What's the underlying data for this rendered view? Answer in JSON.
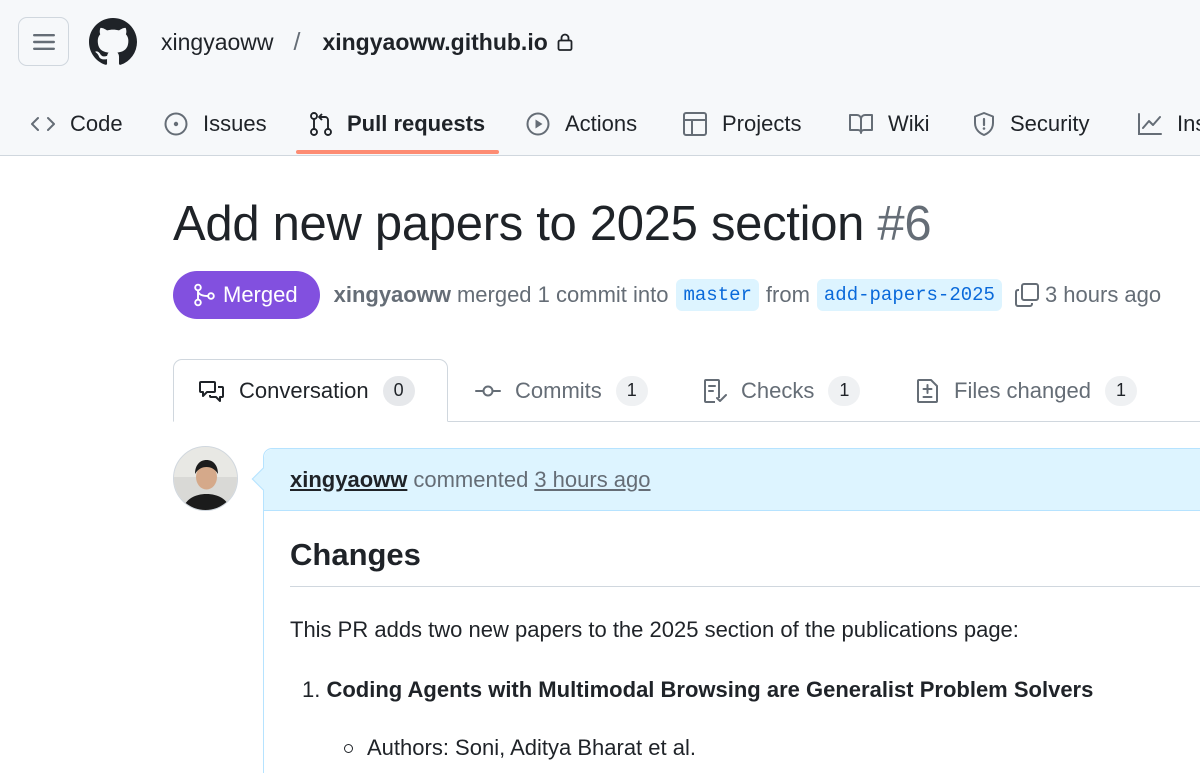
{
  "header": {
    "owner": "xingyaoww",
    "separator": "/",
    "repo": "xingyaoww.github.io",
    "tabs": [
      {
        "label": "Code",
        "icon": "code-icon"
      },
      {
        "label": "Issues",
        "icon": "issue-icon"
      },
      {
        "label": "Pull requests",
        "icon": "pull-request-icon",
        "active": true
      },
      {
        "label": "Actions",
        "icon": "play-icon"
      },
      {
        "label": "Projects",
        "icon": "table-icon"
      },
      {
        "label": "Wiki",
        "icon": "book-icon"
      },
      {
        "label": "Security",
        "icon": "shield-icon"
      },
      {
        "label": "Ins",
        "icon": "graph-icon"
      }
    ]
  },
  "pr": {
    "title": "Add new papers to 2025 section",
    "number": "#6",
    "state": "Merged",
    "author": "xingyaoww",
    "action_text": "merged 1 commit into",
    "base_branch": "master",
    "from_text": "from",
    "head_branch": "add-papers-2025",
    "time": "3 hours ago"
  },
  "pr_tabs": [
    {
      "label": "Conversation",
      "count": "0",
      "icon": "comment-discussion-icon"
    },
    {
      "label": "Commits",
      "count": "1",
      "icon": "commit-icon"
    },
    {
      "label": "Checks",
      "count": "1",
      "icon": "checklist-icon"
    },
    {
      "label": "Files changed",
      "count": "1",
      "icon": "file-diff-icon"
    }
  ],
  "comment": {
    "author": "xingyaoww",
    "verb": "commented",
    "time": "3 hours ago",
    "heading": "Changes",
    "intro": "This PR adds two new papers to the 2025 section of the publications page:",
    "item_number": "1.",
    "item_title": "Coding Agents with Multimodal Browsing are Generalist Problem Solvers",
    "sub_item": "Authors: Soni, Aditya Bharat et al."
  },
  "colors": {
    "merged": "#8250df",
    "active_tab_underline": "#fd8c73",
    "branch_text": "#0969da",
    "branch_bg": "#ddf4ff",
    "comment_header_bg": "#ddf4ff"
  }
}
